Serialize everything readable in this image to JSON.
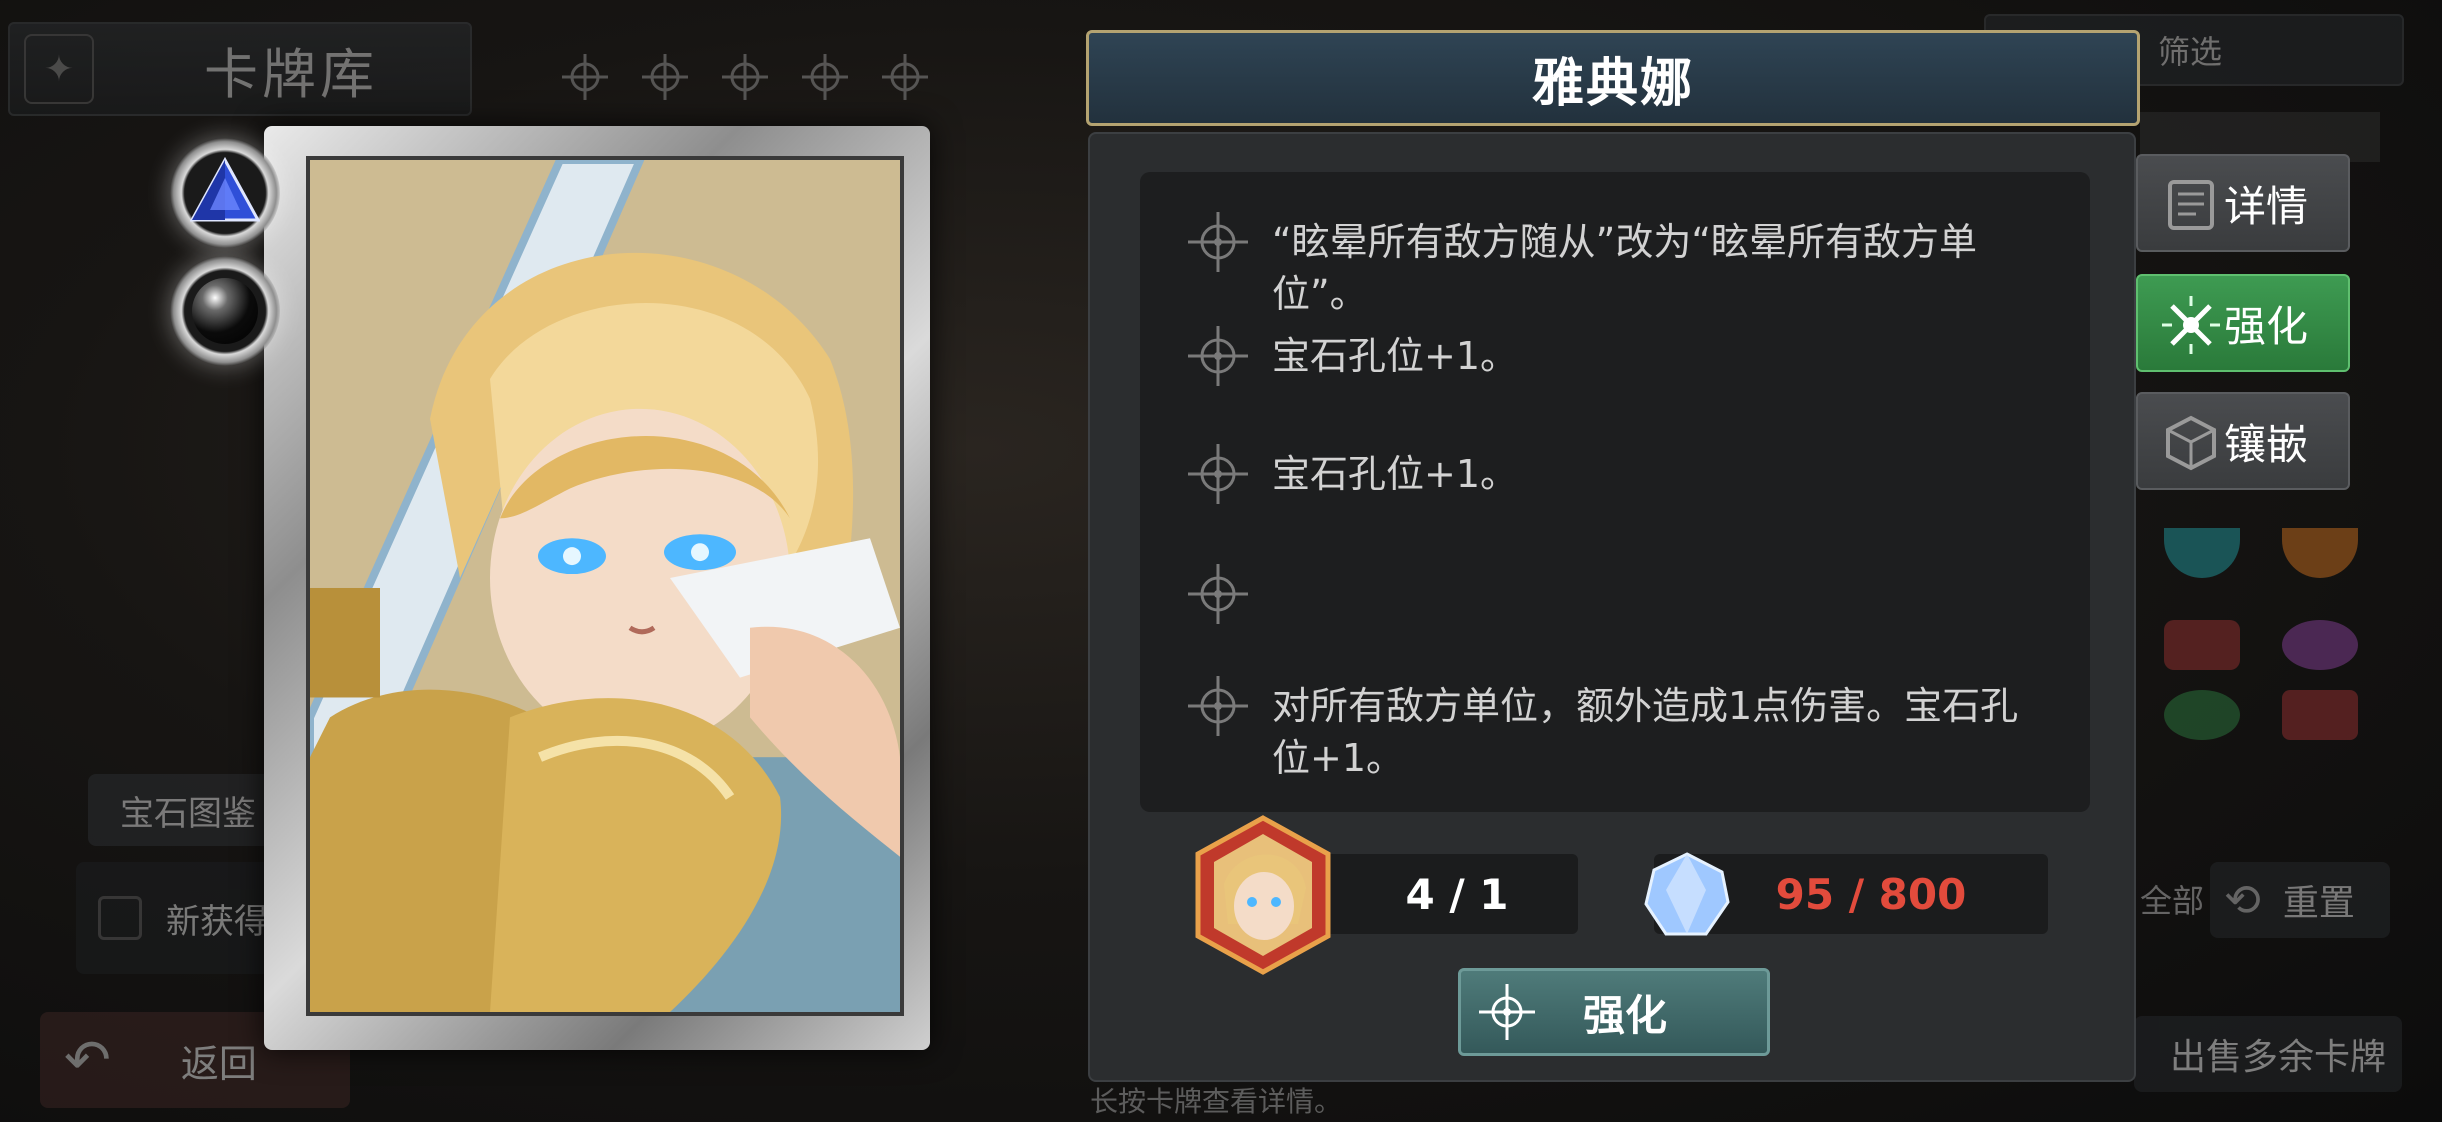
{
  "library": {
    "title": "卡牌库"
  },
  "left_panel": {
    "gem_guide": "宝石图鉴",
    "new_obtained": "新获得",
    "back": "返回"
  },
  "right_panel": {
    "filter": "筛选",
    "all": "全部",
    "reset": "重置",
    "sell_extra": "出售多余卡牌"
  },
  "hint": "长按卡牌查看详情。",
  "card": {
    "name": "雅典娜",
    "gem_sockets": [
      {
        "gem": "sapphire-triangle-gem",
        "color": "#2f4fd8"
      },
      {
        "gem": "black-pearl-gem",
        "color": "#0b0b0b"
      }
    ]
  },
  "effects": [
    {
      "text": "“眩晕所有敌方随从”改为“眩晕所有敌方单位”。"
    },
    {
      "text": "宝石孔位+1。"
    },
    {
      "text": "宝石孔位+1。"
    },
    {
      "text": ""
    },
    {
      "text": "对所有敌方单位，额外造成1点伤害。宝石孔位+1。"
    }
  ],
  "stats": {
    "copies": "4 / 1",
    "material": "95 / 800",
    "material_color": "#e24b3c"
  },
  "actions": {
    "enhance_button": "强化"
  },
  "tabs": {
    "details": "详情",
    "enhance": "强化",
    "inlay": "镶嵌"
  },
  "colors": {
    "accent_green": "#3e9b52",
    "title_gold": "#b4a371",
    "dialog_bg": "#2b2d2f"
  }
}
